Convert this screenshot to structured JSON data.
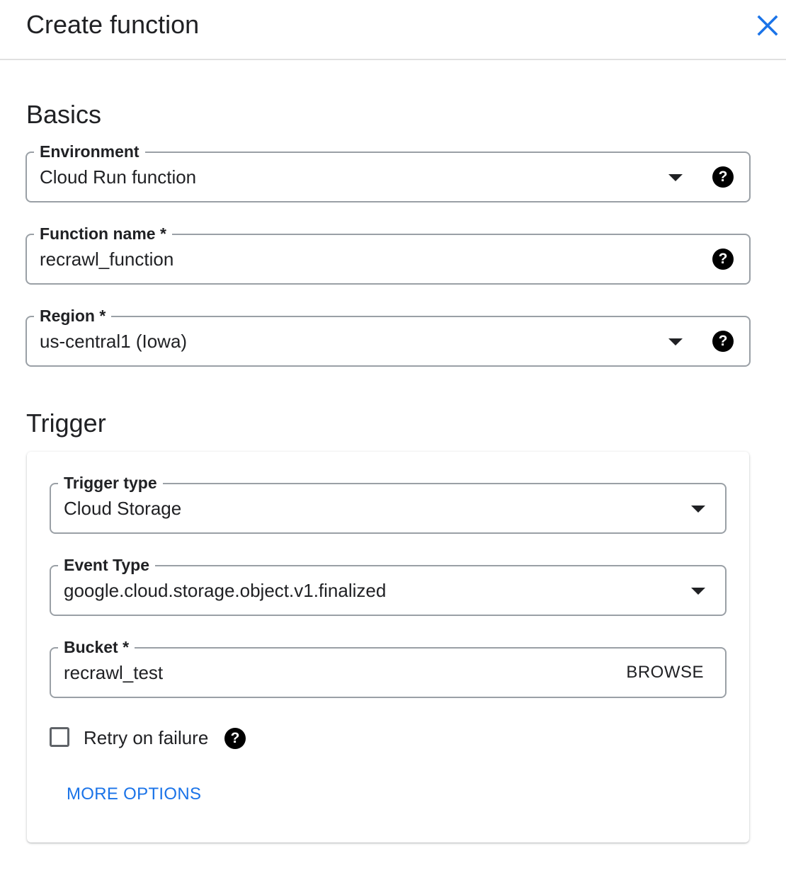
{
  "dialog": {
    "title": "Create function"
  },
  "basics": {
    "heading": "Basics",
    "environment": {
      "label": "Environment",
      "value": "Cloud Run function"
    },
    "function_name": {
      "label": "Function name *",
      "value": "recrawl_function"
    },
    "region": {
      "label": "Region *",
      "value": "us-central1 (Iowa)"
    }
  },
  "trigger": {
    "heading": "Trigger",
    "trigger_type": {
      "label": "Trigger type",
      "value": "Cloud Storage"
    },
    "event_type": {
      "label": "Event Type",
      "value": "google.cloud.storage.object.v1.finalized"
    },
    "bucket": {
      "label": "Bucket *",
      "value": "recrawl_test",
      "browse_label": "BROWSE"
    },
    "retry": {
      "label": "Retry on failure",
      "checked": false
    },
    "more_options_label": "MORE OPTIONS"
  },
  "icons": {
    "close": "close-icon",
    "dropdown": "arrow-drop-down-icon",
    "help": "help-icon",
    "help_glyph": "?"
  },
  "colors": {
    "accent": "#1a73e8",
    "text": "#202124",
    "border": "#9aa0a6",
    "divider": "#e0e0e0"
  }
}
